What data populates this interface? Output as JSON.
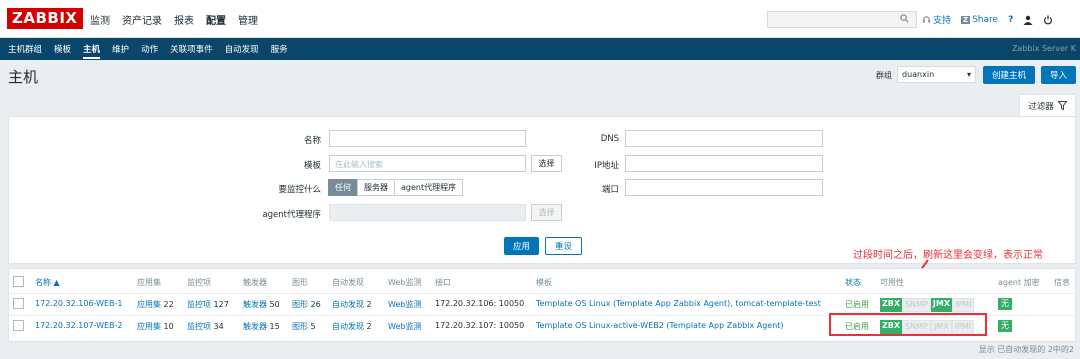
{
  "app": {
    "logo": "ZABBIX",
    "main_menu": [
      "监测",
      "资产记录",
      "报表",
      "配置",
      "管理"
    ],
    "top_links": {
      "support": "支持",
      "share_badge": "Z",
      "share": "Share",
      "help": "?"
    },
    "sub_menu": [
      "主机群组",
      "模板",
      "主机",
      "维护",
      "动作",
      "关联项事件",
      "自动发现",
      "服务"
    ],
    "server_name": "Zabbix Server K"
  },
  "header": {
    "title": "主机",
    "group_label": "群组",
    "group_value": "duanxin",
    "create_button": "创建主机",
    "import_button": "导入"
  },
  "filter": {
    "tab_label": "过滤器",
    "name_label": "名称",
    "template_label": "模板",
    "template_placeholder": "在此输入搜索",
    "select_button": "选择",
    "monitored_by_label": "要监控什么",
    "monitored_by_options": [
      "任何",
      "服务器",
      "agent代理程序"
    ],
    "proxy_label": "agent代理程序",
    "proxy_select": "选择",
    "dns_label": "DNS",
    "ip_label": "IP地址",
    "port_label": "端口",
    "apply_button": "应用",
    "reset_button": "重设"
  },
  "table": {
    "headers": {
      "name": "名称 ▲",
      "apps": "应用集",
      "items": "监控项",
      "triggers": "触发器",
      "graphs": "图形",
      "discovery": "自动发现",
      "web": "Web监测",
      "interface": "接口",
      "templates": "模板",
      "status": "状态",
      "availability": "可用性",
      "encryption": "agent 加密",
      "info": "信息"
    },
    "rows": [
      {
        "name": "172.20.32.106-WEB-1",
        "apps_label": "应用集",
        "apps_count": "22",
        "items_label": "监控项",
        "items_count": "127",
        "triggers_label": "触发器",
        "triggers_count": "50",
        "graphs_label": "图形",
        "graphs_count": "26",
        "discovery_label": "自动发现",
        "discovery_count": "2",
        "web": "Web监测",
        "interface": "172.20.32.106: 10050",
        "templates": "Template OS Linux (Template App Zabbix Agent), tomcat-template-test",
        "status": "已启用",
        "avail": [
          "ZBX",
          "SNMP",
          "JMX",
          "IPMI"
        ],
        "encryption": "无"
      },
      {
        "name": "172.20.32.107-WEB-2",
        "apps_label": "应用集",
        "apps_count": "10",
        "items_label": "监控项",
        "items_count": "34",
        "triggers_label": "触发器",
        "triggers_count": "15",
        "graphs_label": "图形",
        "graphs_count": "5",
        "discovery_label": "自动发现",
        "discovery_count": "2",
        "web": "Web监测",
        "interface": "172.20.32.107: 10050",
        "templates": "Template OS Linux-active-WEB2 (Template App Zabbix Agent)",
        "status": "已启用",
        "avail": [
          "ZBX",
          "SNMP",
          "JMX",
          "IPMI"
        ],
        "encryption": "无"
      }
    ],
    "footer": "显示 已自动发现的 2中的2"
  },
  "annotation": "过段时间之后，刷新这里会变绿，表示正常",
  "colors": {
    "brand": "#d40000",
    "nav": "#0a466a",
    "primary": "#0275b8",
    "ok": "#34af67",
    "annotation": "#e8303a"
  }
}
